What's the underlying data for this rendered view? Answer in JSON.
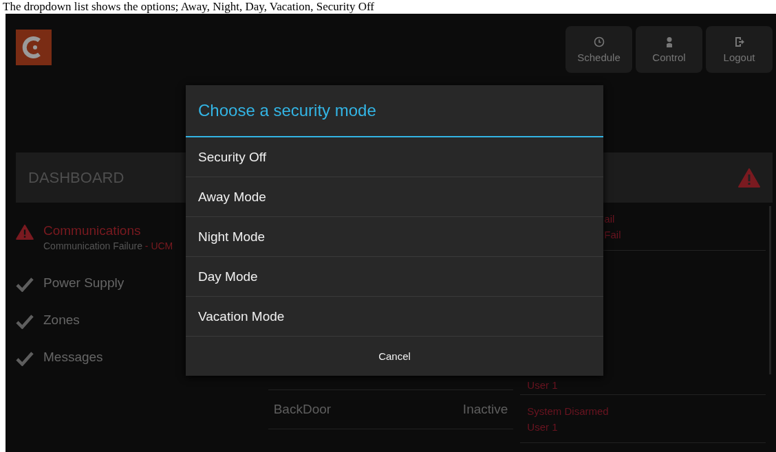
{
  "caption": "The dropdown list shows the options; Away, Night, Day, Vacation, Security Off",
  "toolbar": [
    {
      "label": "Schedule",
      "kind": "clock"
    },
    {
      "label": "Control",
      "kind": "person"
    },
    {
      "label": "Logout",
      "kind": "exit"
    }
  ],
  "dashboard": {
    "title": "DASHBOARD",
    "alert": true,
    "items": [
      {
        "label": "Communications",
        "kind": "alert",
        "detail": "Communication Failure",
        "source": "- UCM"
      },
      {
        "label": "Power Supply",
        "kind": "ok"
      },
      {
        "label": "Zones",
        "kind": "ok"
      },
      {
        "label": "Messages",
        "kind": "ok"
      }
    ]
  },
  "zones": [
    {
      "name": "BackDoor",
      "state": "Inactive"
    }
  ],
  "events": [
    {
      "lines": [
        "ail",
        "Fail"
      ]
    },
    {
      "lines": [
        "User 1"
      ]
    },
    {
      "lines": [
        "System Disarmed",
        "User 1"
      ]
    }
  ],
  "dialog": {
    "title": "Choose a security mode",
    "options": [
      "Security Off",
      "Away Mode",
      "Night Mode",
      "Day Mode",
      "Vacation Mode"
    ],
    "cancel": "Cancel"
  }
}
